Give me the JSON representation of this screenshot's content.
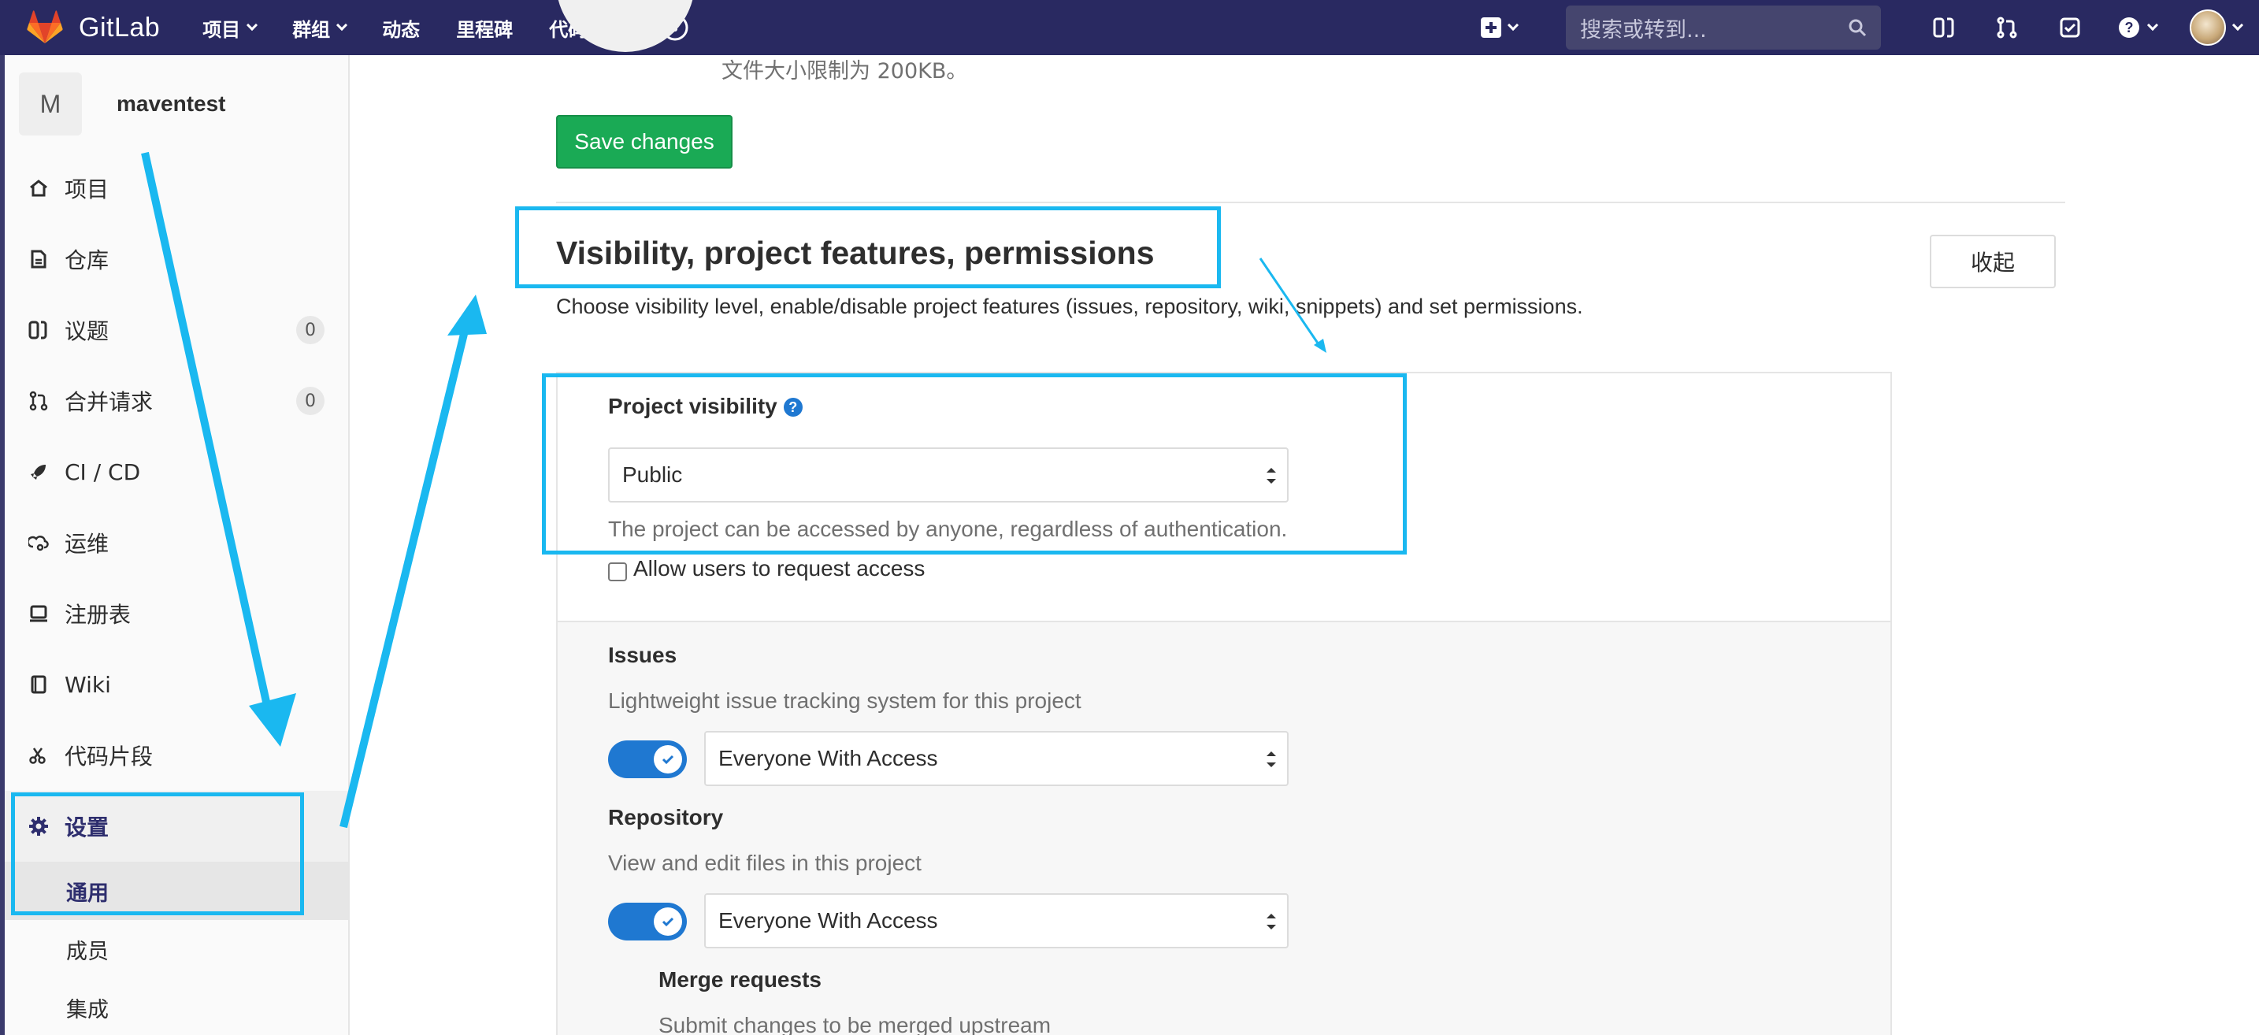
{
  "app": {
    "brand": "GitLab"
  },
  "nav": {
    "links": [
      "项目",
      "群组",
      "动态",
      "里程碑",
      "代码片段"
    ],
    "search_placeholder": "搜索或转到..."
  },
  "sidebar": {
    "project_initial": "M",
    "project_name": "maventest",
    "items": [
      {
        "label": "项目",
        "icon": "home-icon"
      },
      {
        "label": "仓库",
        "icon": "file-icon"
      },
      {
        "label": "议题",
        "icon": "issues-icon",
        "badge": "0"
      },
      {
        "label": "合并请求",
        "icon": "merge-request-icon",
        "badge": "0"
      },
      {
        "label": "CI / CD",
        "icon": "rocket-icon"
      },
      {
        "label": "运维",
        "icon": "operations-icon"
      },
      {
        "label": "注册表",
        "icon": "registry-icon"
      },
      {
        "label": "Wiki",
        "icon": "book-icon"
      },
      {
        "label": "代码片段",
        "icon": "scissors-icon"
      },
      {
        "label": "设置",
        "icon": "gear-icon"
      }
    ],
    "sub_items": [
      "通用",
      "成员",
      "集成"
    ]
  },
  "main": {
    "avatar_hint": "文件大小限制为 200KB。",
    "save_label": "Save changes",
    "section": {
      "title": "Visibility, project features, permissions",
      "description": "Choose visibility level, enable/disable project features (issues, repository, wiki, snippets) and set permissions.",
      "collapse_label": "收起"
    },
    "visibility": {
      "label": "Project visibility",
      "value": "Public",
      "help": "The project can be accessed by anyone, regardless of authentication.",
      "request_access_label": "Allow users to request access",
      "request_access_checked": false
    },
    "features": {
      "issues": {
        "label": "Issues",
        "description": "Lightweight issue tracking system for this project",
        "enabled": true,
        "value": "Everyone With Access"
      },
      "repository": {
        "label": "Repository",
        "description": "View and edit files in this project",
        "enabled": true,
        "value": "Everyone With Access"
      },
      "merge_requests": {
        "label": "Merge requests",
        "description": "Submit changes to be merged upstream"
      }
    }
  },
  "colors": {
    "nav_bg": "#292961",
    "save_green": "#1aaa55",
    "toggle_blue": "#1f78d1",
    "annotation_blue": "#1ab8f0"
  }
}
